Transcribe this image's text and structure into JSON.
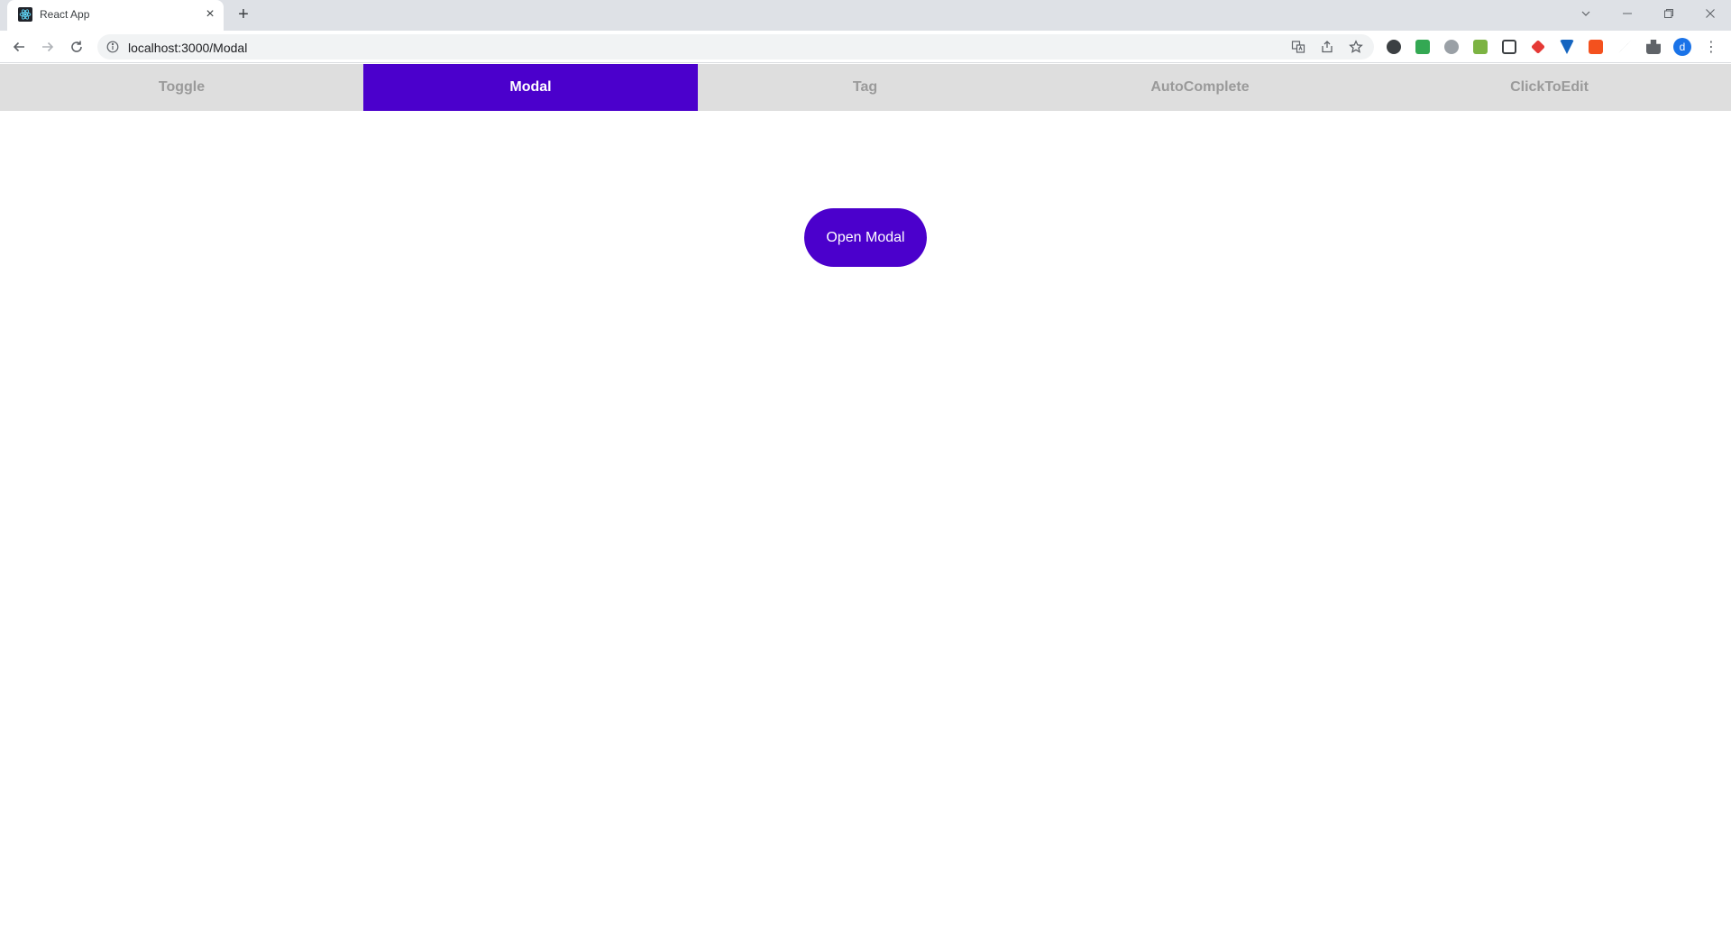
{
  "browser": {
    "tab_title": "React App",
    "tab_close": "×",
    "new_tab": "+",
    "url": "localhost:3000/Modal",
    "profile_initial": "d",
    "menu": "⋮"
  },
  "app": {
    "nav_items": [
      {
        "label": "Toggle"
      },
      {
        "label": "Modal"
      },
      {
        "label": "Tag"
      },
      {
        "label": "AutoComplete"
      },
      {
        "label": "ClickToEdit"
      }
    ],
    "active_index": 1,
    "open_modal_label": "Open Modal"
  },
  "colors": {
    "accent": "#4b00cc",
    "nav_bg": "#dedede",
    "nav_text": "#9a9a9a"
  }
}
